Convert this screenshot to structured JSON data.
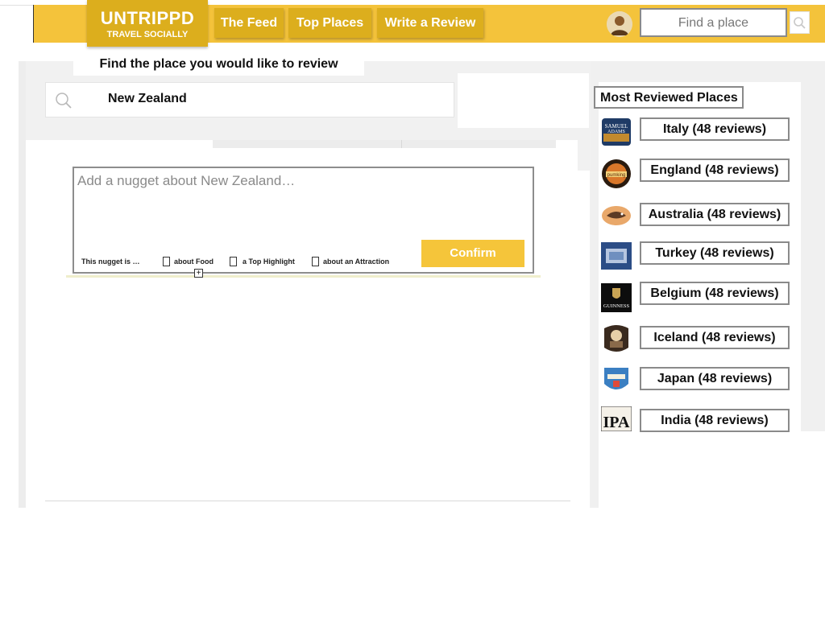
{
  "brand": {
    "title": "UNTRIPPD",
    "tagline": "TRAVEL SOCIALLY"
  },
  "nav": {
    "feed": "The Feed",
    "top_places": "Top Places",
    "write_review": "Write a Review"
  },
  "header_search": {
    "placeholder": "Find a place"
  },
  "review": {
    "heading": "Find the place you would like to review",
    "search_value": "New Zealand",
    "nugget_placeholder": "Add a nugget about New Zealand…",
    "nugget_is": "This nugget is …",
    "options": [
      "about Food",
      "a Top Highlight",
      "about an Attraction"
    ],
    "confirm": "Confirm"
  },
  "sidebar": {
    "title": "Most Reviewed Places",
    "places": [
      {
        "label": "Italy (48 reviews)",
        "thumb": "samuel-adams-logo"
      },
      {
        "label": "England (48 reviews)",
        "thumb": "pumking-logo"
      },
      {
        "label": "Australia (48 reviews)",
        "thumb": "dogfish-logo"
      },
      {
        "label": "Turkey (48 reviews)",
        "thumb": "blue-label-logo"
      },
      {
        "label": "Belgium (48 reviews)",
        "thumb": "guinness-logo"
      },
      {
        "label": "Iceland (48 reviews)",
        "thumb": "portrait-label-logo"
      },
      {
        "label": "Japan (48 reviews)",
        "thumb": "oktoberfest-logo"
      },
      {
        "label": "India (48 reviews)",
        "thumb": "ipa-logo"
      }
    ]
  },
  "colors": {
    "brand_yellow": "#f4c33b",
    "brand_dark_yellow": "#dcae1d"
  }
}
